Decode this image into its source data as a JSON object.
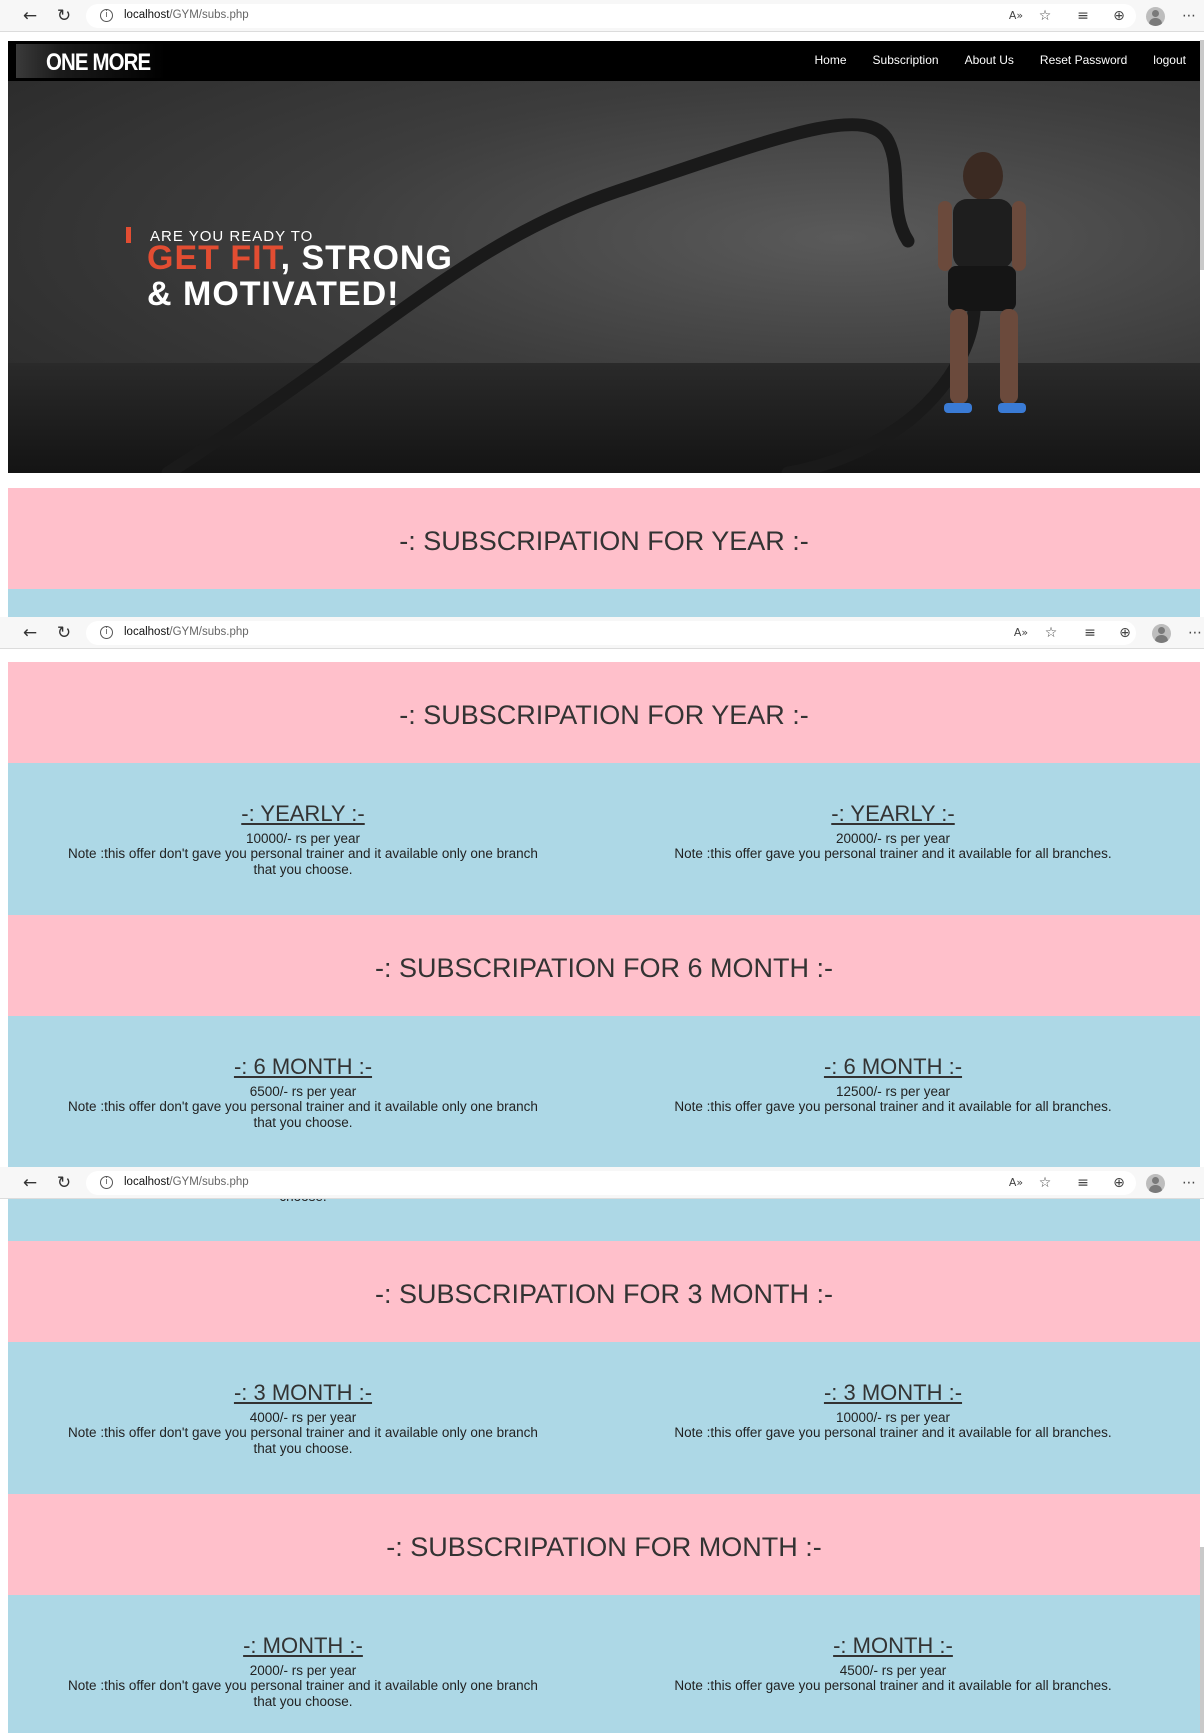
{
  "browser": {
    "url_host": "localhost",
    "url_path": "/GYM/subs.php"
  },
  "site": {
    "logo": "ONE MORE",
    "nav": [
      "Home",
      "Subscription",
      "About Us",
      "Reset Password",
      "logout"
    ]
  },
  "hero": {
    "line1": "ARE YOU READY TO",
    "accent": "GET FIT",
    "line2_rest": ", STRONG",
    "line3": "& MOTIVATED!"
  },
  "sections": [
    {
      "heading": "-: SUBSCRIPATION FOR YEAR :-",
      "plans": [
        {
          "title": "-: YEARLY :-",
          "price": "10000/- rs per year",
          "note": "Note :this offer don't gave you personal trainer and it available only one branch that you choose."
        },
        {
          "title": "-: YEARLY :-",
          "price": "20000/- rs per year",
          "note": "Note :this offer gave you personal trainer and it available for all branches."
        }
      ]
    },
    {
      "heading": "-: SUBSCRIPATION FOR 6 MONTH :-",
      "plans": [
        {
          "title": "-: 6 MONTH :-",
          "price": "6500/- rs per year",
          "note": "Note :this offer don't gave you personal trainer and it available only one branch that you choose."
        },
        {
          "title": "-: 6 MONTH :-",
          "price": "12500/- rs per year",
          "note": "Note :this offer gave you personal trainer and it available for all branches."
        }
      ]
    },
    {
      "heading": "-: SUBSCRIPATION FOR 3 MONTH :-",
      "plans": [
        {
          "title": "-: 3 MONTH :-",
          "price": "4000/- rs per year",
          "note": "Note :this offer don't gave you personal trainer and it available only one branch that you choose."
        },
        {
          "title": "-: 3 MONTH :-",
          "price": "10000/- rs per year",
          "note": "Note :this offer gave you personal trainer and it available for all branches."
        }
      ]
    },
    {
      "heading": "-: SUBSCRIPATION FOR MONTH :-",
      "plans": [
        {
          "title": "-: MONTH :-",
          "price": "2000/- rs per year",
          "note": "Note :this offer don't gave you personal trainer and it available only one branch that you choose."
        },
        {
          "title": "-: MONTH :-",
          "price": "4500/- rs per year",
          "note": "Note :this offer gave you personal trainer and it available for all branches."
        }
      ]
    }
  ],
  "cut_text": "choose."
}
